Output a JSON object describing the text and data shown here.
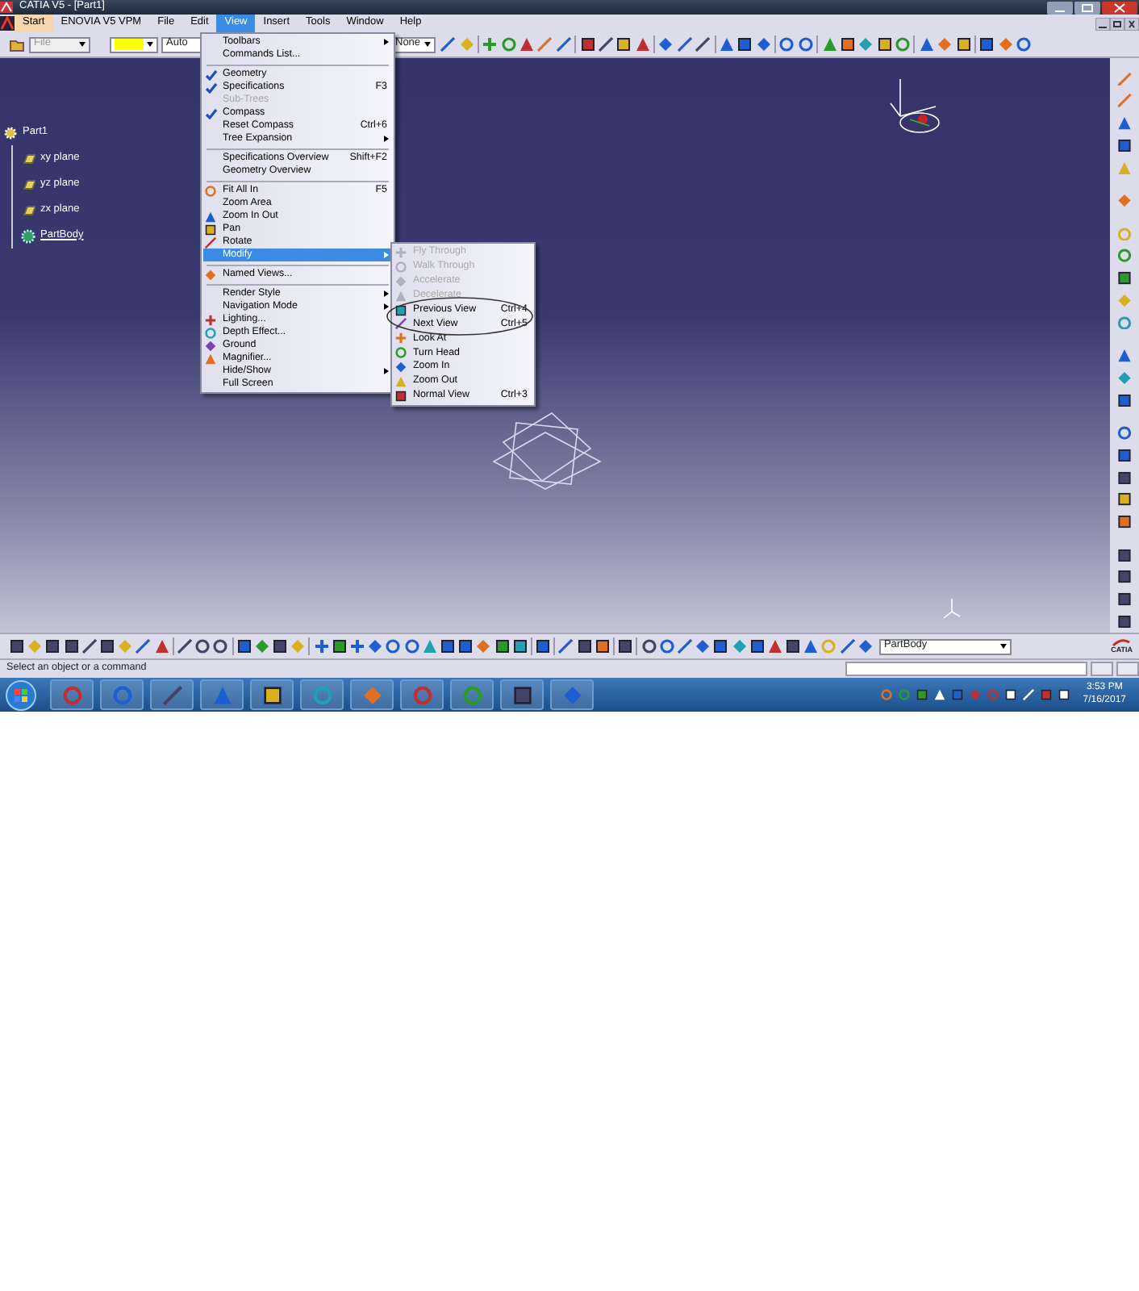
{
  "window": {
    "title": "CATIA V5 - [Part1]"
  },
  "menu_bar": [
    {
      "label": "Start",
      "selected": false
    },
    {
      "label": "ENOVIA V5 VPM",
      "selected": false
    },
    {
      "label": "File",
      "selected": false
    },
    {
      "label": "Edit",
      "selected": false
    },
    {
      "label": "View",
      "selected": true
    },
    {
      "label": "Insert",
      "selected": false
    },
    {
      "label": "Tools",
      "selected": false
    },
    {
      "label": "Window",
      "selected": false
    },
    {
      "label": "Help",
      "selected": false
    }
  ],
  "toolbar": {
    "file_dropdown": "File",
    "color": "#ffff00",
    "line_style": "Auto",
    "layer": "None"
  },
  "view_menu": [
    {
      "kind": "plain",
      "label": "Toolbars",
      "submenu": true,
      "disabled": false,
      "selected": false
    },
    {
      "kind": "plain",
      "label": "Commands List...",
      "submenu": false,
      "disabled": false,
      "selected": false
    },
    {
      "kind": "separator"
    },
    {
      "kind": "check",
      "label": "Geometry",
      "checked": true,
      "submenu": false,
      "disabled": false,
      "selected": false
    },
    {
      "kind": "check",
      "label": "Specifications",
      "shortcut": "F3",
      "checked": true,
      "submenu": false,
      "disabled": false,
      "selected": false
    },
    {
      "kind": "check",
      "label": "Sub-Trees",
      "checked": false,
      "submenu": false,
      "disabled": true,
      "selected": false
    },
    {
      "kind": "check",
      "label": "Compass",
      "checked": true,
      "submenu": false,
      "disabled": false,
      "selected": false
    },
    {
      "kind": "plain",
      "label": "Reset Compass",
      "shortcut": "Ctrl+6",
      "submenu": false,
      "disabled": false,
      "selected": false
    },
    {
      "kind": "plain",
      "label": "Tree Expansion",
      "submenu": true,
      "disabled": false,
      "selected": false
    },
    {
      "kind": "separator"
    },
    {
      "kind": "plain",
      "label": "Specifications Overview",
      "shortcut": "Shift+F2",
      "submenu": false,
      "disabled": false,
      "selected": false
    },
    {
      "kind": "plain",
      "label": "Geometry Overview",
      "submenu": false,
      "disabled": false,
      "selected": false
    },
    {
      "kind": "separator"
    },
    {
      "kind": "icon",
      "label": "Fit All In",
      "shortcut": "F5",
      "submenu": false,
      "disabled": false,
      "selected": false
    },
    {
      "kind": "plain",
      "label": "Zoom Area",
      "submenu": false,
      "disabled": false,
      "selected": false
    },
    {
      "kind": "icon",
      "label": "Zoom In Out",
      "submenu": false,
      "disabled": false,
      "selected": false
    },
    {
      "kind": "icon",
      "label": "Pan",
      "submenu": false,
      "disabled": false,
      "selected": false
    },
    {
      "kind": "icon",
      "label": "Rotate",
      "submenu": false,
      "disabled": false,
      "selected": false
    },
    {
      "kind": "plain",
      "label": "Modify",
      "submenu": true,
      "disabled": false,
      "selected": true
    },
    {
      "kind": "separator"
    },
    {
      "kind": "icon",
      "label": "Named Views...",
      "submenu": false,
      "disabled": false,
      "selected": false
    },
    {
      "kind": "separator"
    },
    {
      "kind": "plain",
      "label": "Render Style",
      "submenu": true,
      "disabled": false,
      "selected": false
    },
    {
      "kind": "plain",
      "label": "Navigation Mode",
      "submenu": true,
      "disabled": false,
      "selected": false
    },
    {
      "kind": "icon",
      "label": "Lighting...",
      "submenu": false,
      "disabled": false,
      "selected": false
    },
    {
      "kind": "icon",
      "label": "Depth Effect...",
      "submenu": false,
      "disabled": false,
      "selected": false
    },
    {
      "kind": "icon",
      "label": "Ground",
      "submenu": false,
      "disabled": false,
      "selected": false
    },
    {
      "kind": "icon",
      "label": "Magnifier...",
      "submenu": false,
      "disabled": false,
      "selected": false
    },
    {
      "kind": "plain",
      "label": "Hide/Show",
      "submenu": true,
      "disabled": false,
      "selected": false
    },
    {
      "kind": "plain",
      "label": "Full Screen",
      "submenu": false,
      "disabled": false,
      "selected": false
    }
  ],
  "modify_submenu": [
    {
      "kind": "icon",
      "label": "Fly Through",
      "submenu": false,
      "disabled": true,
      "selected": false
    },
    {
      "kind": "icon",
      "label": "Walk Through",
      "submenu": false,
      "disabled": true,
      "selected": false
    },
    {
      "kind": "icon",
      "label": "Accelerate",
      "submenu": false,
      "disabled": true,
      "selected": false
    },
    {
      "kind": "icon",
      "label": "Decelerate",
      "submenu": false,
      "disabled": true,
      "selected": false
    },
    {
      "kind": "icon",
      "label": "Previous View",
      "shortcut": "Ctrl+4",
      "submenu": false,
      "disabled": false,
      "selected": false
    },
    {
      "kind": "icon",
      "label": "Next View",
      "shortcut": "Ctrl+5",
      "submenu": false,
      "disabled": false,
      "selected": false
    },
    {
      "kind": "icon",
      "label": "Look At",
      "submenu": false,
      "disabled": false,
      "selected": false
    },
    {
      "kind": "icon",
      "label": "Turn Head",
      "submenu": false,
      "disabled": false,
      "selected": false
    },
    {
      "kind": "icon",
      "label": "Zoom In",
      "submenu": false,
      "disabled": false,
      "selected": false
    },
    {
      "kind": "icon",
      "label": "Zoom Out",
      "submenu": false,
      "disabled": false,
      "selected": false
    },
    {
      "kind": "icon",
      "label": "Normal View",
      "shortcut": "Ctrl+3",
      "submenu": false,
      "disabled": false,
      "selected": false
    }
  ],
  "spec_tree": {
    "label": "Part1",
    "kind": "part",
    "children": [
      {
        "label": "xy plane",
        "kind": "plane"
      },
      {
        "label": "yz plane",
        "kind": "plane"
      },
      {
        "label": "zx plane",
        "kind": "plane"
      },
      {
        "label": "PartBody",
        "kind": "body"
      }
    ]
  },
  "bottom_toolbar": {
    "body_dropdown": "PartBody"
  },
  "logo": "CATIA",
  "status_bar": {
    "message": "Select an object or a command"
  },
  "taskbar": {
    "time": "3:53 PM",
    "date": "7/16/2017"
  }
}
